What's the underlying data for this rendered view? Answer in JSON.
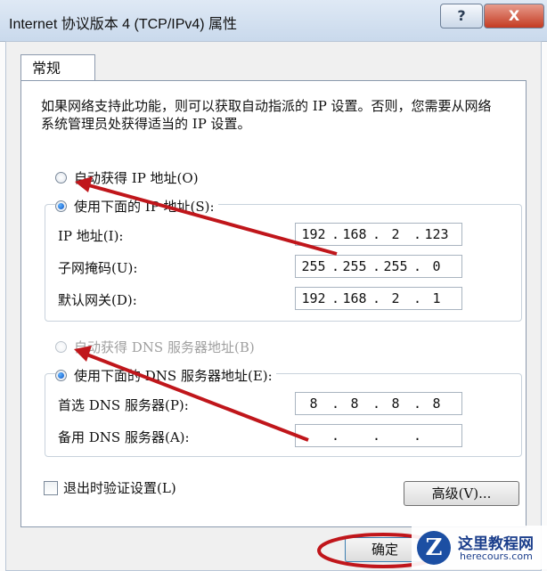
{
  "window": {
    "title": "Internet 协议版本 4 (TCP/IPv4) 属性",
    "help_label": "?",
    "close_label": "X"
  },
  "tab": {
    "label": "常规"
  },
  "intro_text": "如果网络支持此功能，则可以获取自动指派的 IP 设置。否则，您需要从网络系统管理员处获得适当的 IP 设置。",
  "ip_section": {
    "auto_label": "自动获得 IP 地址(O)",
    "auto_selected": false,
    "manual_label": "使用下面的 IP 地址(S):",
    "manual_selected": true,
    "fields": [
      {
        "label": "IP 地址(I):",
        "value": [
          "192",
          "168",
          "2",
          "123"
        ]
      },
      {
        "label": "子网掩码(U):",
        "value": [
          "255",
          "255",
          "255",
          "0"
        ]
      },
      {
        "label": "默认网关(D):",
        "value": [
          "192",
          "168",
          "2",
          "1"
        ]
      }
    ]
  },
  "dns_section": {
    "auto_label": "自动获得 DNS 服务器地址(B)",
    "auto_selected": false,
    "auto_disabled": true,
    "manual_label": "使用下面的 DNS 服务器地址(E):",
    "manual_selected": true,
    "fields": [
      {
        "label": "首选 DNS 服务器(P):",
        "value": [
          "8",
          "8",
          "8",
          "8"
        ]
      },
      {
        "label": "备用 DNS 服务器(A):",
        "value": [
          "",
          "",
          "",
          ""
        ]
      }
    ]
  },
  "validate_label": "退出时验证设置(L)",
  "validate_checked": false,
  "advanced_label": "高级(V)...",
  "ok_label": "确定",
  "annotation_color": "#c0161b",
  "watermark": {
    "logo": "Z",
    "title": "这里教程网",
    "subtitle": "herecours.com"
  }
}
